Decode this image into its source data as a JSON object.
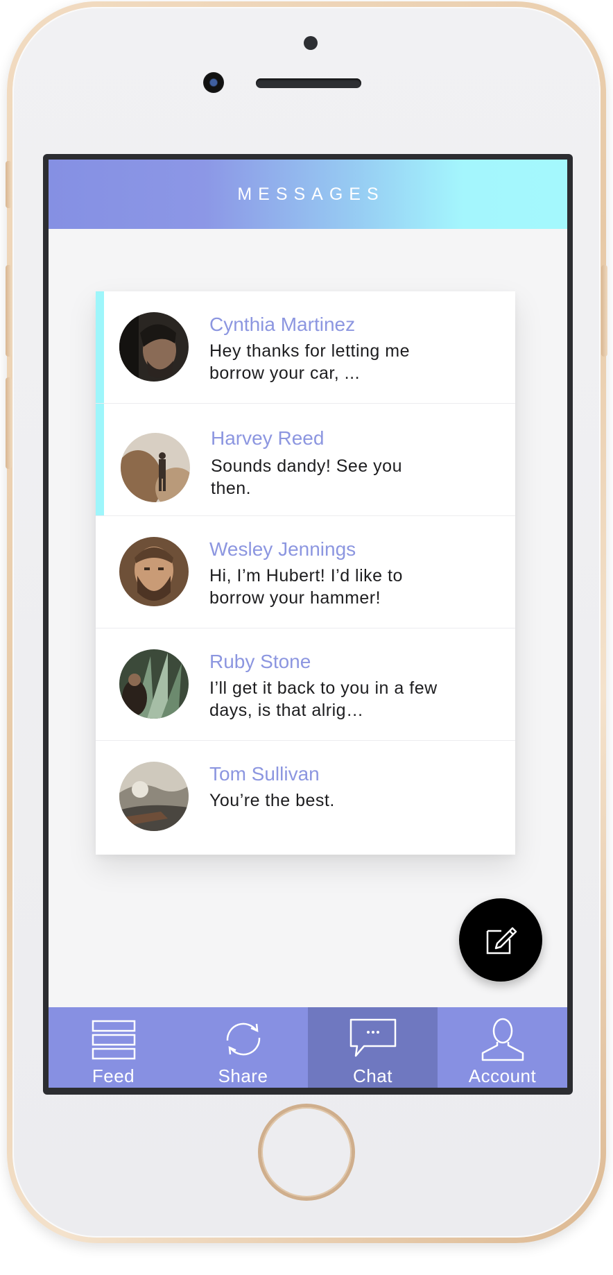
{
  "header": {
    "title": "MESSAGES"
  },
  "messages": [
    {
      "name": "Cynthia Martinez",
      "preview": "Hey thanks for letting me borrow your car, ...",
      "unread": true,
      "avatar": "portrait-man-dark-hair"
    },
    {
      "name": "Harvey Reed",
      "preview": "Sounds dandy! See you then.",
      "unread": true,
      "avatar": "person-standing-outdoors"
    },
    {
      "name": "Wesley Jennings",
      "preview": "Hi, I’m Hubert! I’d like to borrow your hammer!",
      "unread": false,
      "avatar": "portrait-bearded-man"
    },
    {
      "name": "Ruby Stone",
      "preview": "I’ll get it back to you in a few days, is that alrig…",
      "unread": false,
      "avatar": "person-in-plants"
    },
    {
      "name": "Tom Sullivan",
      "preview": "You’re the best.",
      "unread": false,
      "avatar": "rocky-landscape"
    }
  ],
  "fab": {
    "icon": "compose-icon"
  },
  "tabs": [
    {
      "label": "Feed",
      "icon": "feed-icon",
      "active": false
    },
    {
      "label": "Share",
      "icon": "share-icon",
      "active": false
    },
    {
      "label": "Chat",
      "icon": "chat-icon",
      "active": true
    },
    {
      "label": "Account",
      "icon": "account-icon",
      "active": false
    }
  ],
  "colors": {
    "accent": "#8c96e0",
    "unread_marker": "#9ef6fb",
    "tabbar": "#8790e2",
    "tab_active": "#6f78c0",
    "header_gradient": [
      "#8590e3",
      "#a4f8fd"
    ]
  }
}
